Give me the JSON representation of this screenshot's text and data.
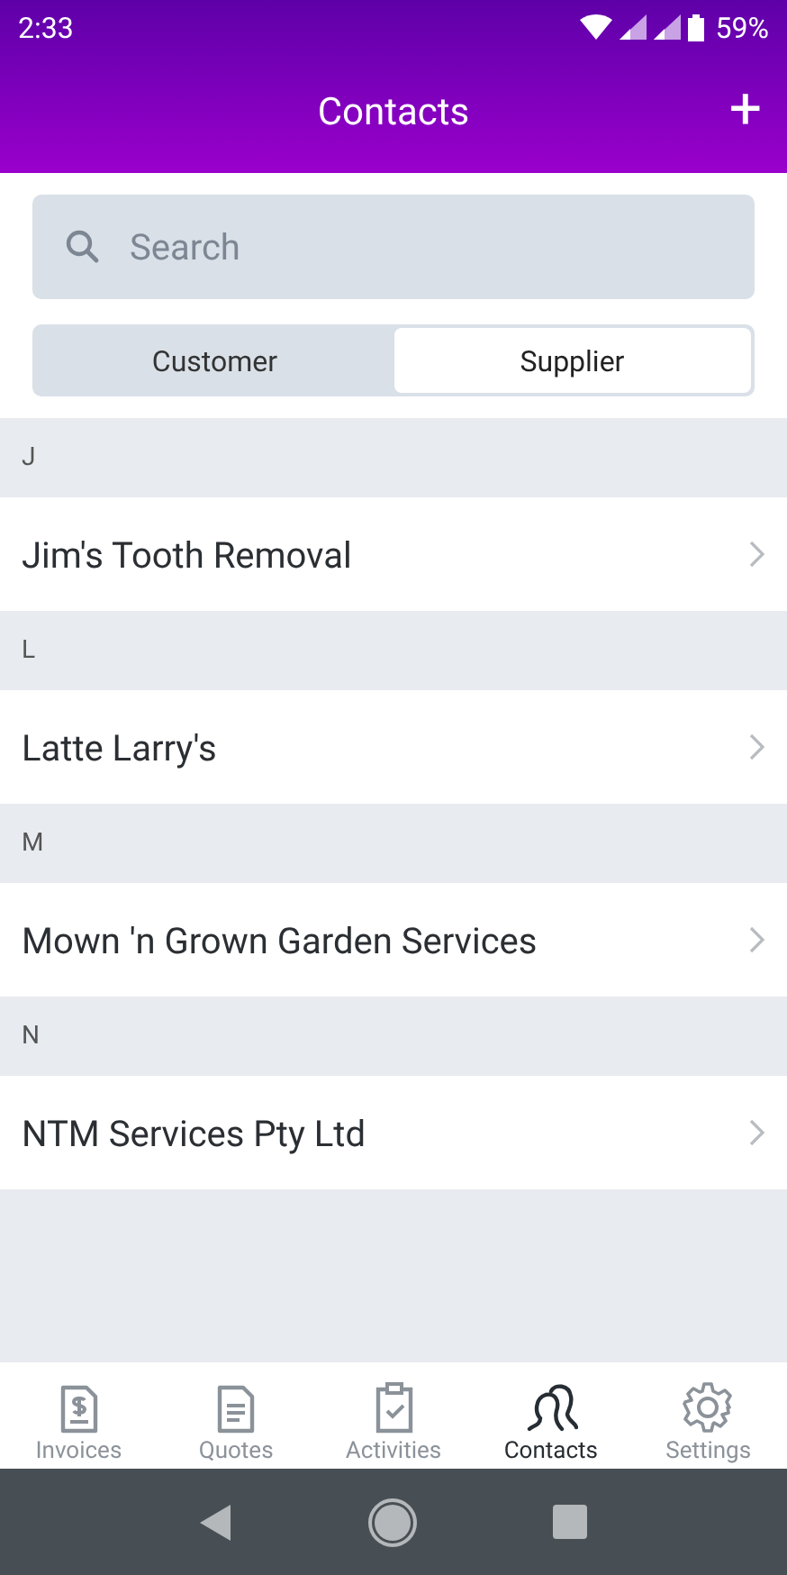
{
  "status_bar": {
    "time": "2:33",
    "battery": "59%"
  },
  "header": {
    "title": "Contacts",
    "action": "+"
  },
  "search": {
    "placeholder": "Search"
  },
  "segments": [
    {
      "label": "Customer",
      "selected": false
    },
    {
      "label": "Supplier",
      "selected": true
    }
  ],
  "sections": [
    {
      "letter": "J",
      "items": [
        "Jim's Tooth Removal"
      ]
    },
    {
      "letter": "L",
      "items": [
        "Latte Larry's"
      ]
    },
    {
      "letter": "M",
      "items": [
        "Mown 'n Grown Garden Services"
      ]
    },
    {
      "letter": "N",
      "items": [
        "NTM Services Pty Ltd"
      ]
    }
  ],
  "tab_bar": [
    {
      "label": "Invoices",
      "selected": false
    },
    {
      "label": "Quotes",
      "selected": false
    },
    {
      "label": "Activities",
      "selected": false
    },
    {
      "label": "Contacts",
      "selected": true
    },
    {
      "label": "Settings",
      "selected": false
    }
  ]
}
